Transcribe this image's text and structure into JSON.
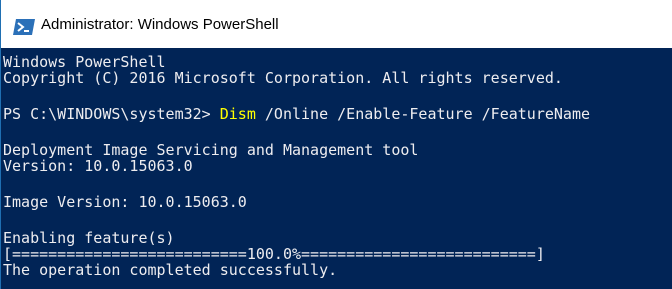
{
  "window": {
    "title": "Administrator: Windows PowerShell",
    "icon": "powershell-icon"
  },
  "console": {
    "banner_line1": "Windows PowerShell",
    "banner_line2": "Copyright (C) 2016 Microsoft Corporation. All rights reserved.",
    "prompt": "PS C:\\WINDOWS\\system32> ",
    "command": "Dism",
    "command_args": " /Online /Enable-Feature /FeatureName",
    "tool_name": "Deployment Image Servicing and Management tool",
    "tool_version": "Version: 10.0.15063.0",
    "image_version": "Image Version: 10.0.15063.0",
    "enabling": "Enabling feature(s)",
    "progress_bar": "[==========================100.0%==========================]",
    "result": "The operation completed successfully."
  },
  "colors": {
    "console_background": "#012456",
    "console_text": "#eeedf0",
    "command_highlight": "#ffff00"
  }
}
